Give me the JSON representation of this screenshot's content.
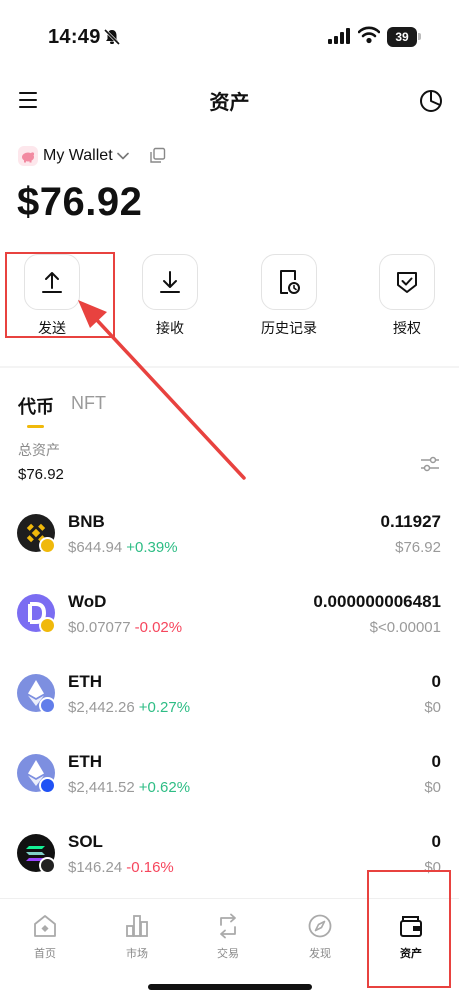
{
  "status_bar": {
    "time": "14:49",
    "battery": "39"
  },
  "header": {
    "title": "资产"
  },
  "wallet": {
    "name": "My Wallet",
    "balance": "$76.92"
  },
  "actions": [
    {
      "label": "发送",
      "icon": "upload-icon"
    },
    {
      "label": "接收",
      "icon": "download-icon"
    },
    {
      "label": "历史记录",
      "icon": "history-icon"
    },
    {
      "label": "授权",
      "icon": "shield-check-icon"
    }
  ],
  "tabs": {
    "tokens": "代币",
    "nft": "NFT"
  },
  "summary": {
    "label": "总资产",
    "value": "$76.92"
  },
  "tokens": [
    {
      "symbol": "BNB",
      "price": "$644.94",
      "change": "+0.39%",
      "amount": "0.11927",
      "value": "$76.92"
    },
    {
      "symbol": "WoD",
      "price": "$0.07077",
      "change": "-0.02%",
      "amount": "0.000000006481",
      "value": "$<0.00001"
    },
    {
      "symbol": "ETH",
      "price": "$2,442.26",
      "change": "+0.27%",
      "amount": "0",
      "value": "$0"
    },
    {
      "symbol": "ETH",
      "price": "$2,441.52",
      "change": "+0.62%",
      "amount": "0",
      "value": "$0"
    },
    {
      "symbol": "SOL",
      "price": "$146.24",
      "change": "-0.16%",
      "amount": "0",
      "value": "$0"
    }
  ],
  "bottom_nav": [
    {
      "label": "首页",
      "icon": "home-icon"
    },
    {
      "label": "市场",
      "icon": "market-icon"
    },
    {
      "label": "交易",
      "icon": "swap-icon"
    },
    {
      "label": "发现",
      "icon": "compass-icon"
    },
    {
      "label": "资产",
      "icon": "wallet-icon",
      "active": true
    }
  ],
  "colors": {
    "accent": "#f0b90b",
    "up": "#2ebd85",
    "down": "#f6465d",
    "annotation": "#e8423f"
  }
}
